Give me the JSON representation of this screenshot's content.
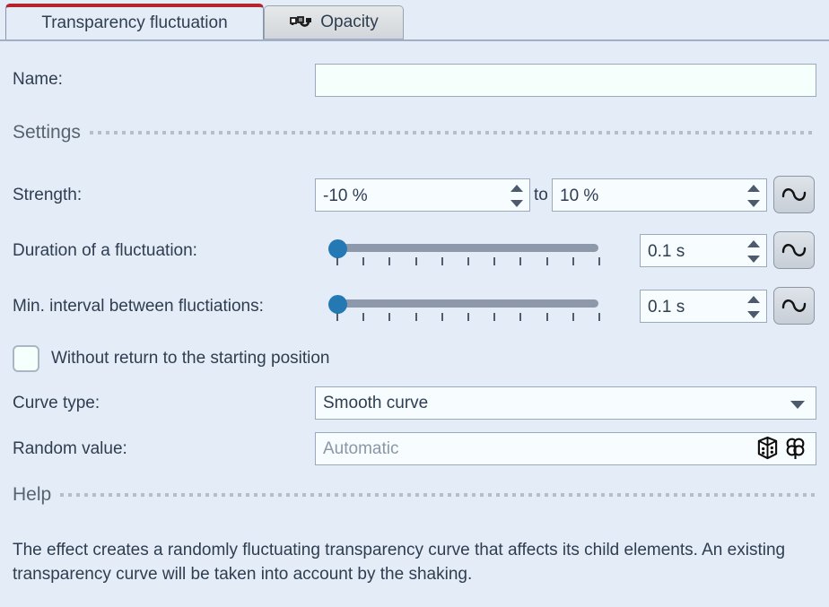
{
  "tabs": [
    {
      "label": "Transparency fluctuation",
      "active": true,
      "icon": ""
    },
    {
      "label": "Opacity",
      "active": false,
      "icon": "opacity-curve-icon"
    }
  ],
  "fields": {
    "name_label": "Name:",
    "name_value": "",
    "name_placeholder": ""
  },
  "sections": {
    "settings_title": "Settings",
    "help_title": "Help"
  },
  "strength": {
    "label": "Strength:",
    "from_value": "-10 %",
    "to_word": "to",
    "to_value": "10 %",
    "wave_button": "sine-wave-icon"
  },
  "duration": {
    "label": "Duration of a fluctuation:",
    "value": "0.1 s",
    "slider_position_percent": 0,
    "tick_count": 11,
    "wave_button": "sine-wave-icon"
  },
  "interval": {
    "label": "Min. interval between fluctiations:",
    "value": "0.1 s",
    "slider_position_percent": 0,
    "tick_count": 11,
    "wave_button": "sine-wave-icon"
  },
  "checkbox": {
    "label": "Without return to the starting position",
    "checked": false
  },
  "curve_type": {
    "label": "Curve type:",
    "value": "Smooth curve",
    "options": [
      "Smooth curve"
    ]
  },
  "random_value": {
    "label": "Random value:",
    "placeholder": "Automatic",
    "value": "",
    "dice_icon": "dice-icon",
    "clover_icon": "clover-icon"
  },
  "help": {
    "text": "The effect creates a randomly fluctuating transparency curve that affects its child elements. An existing transparency curve will be taken into account by the shaking."
  },
  "colors": {
    "background": "#e4ecf7",
    "accent_red": "#b3252c",
    "slider_handle": "#2479b4",
    "slider_track": "#8d99ab",
    "text": "#2e3d50",
    "input_background": "#f5fffc"
  }
}
